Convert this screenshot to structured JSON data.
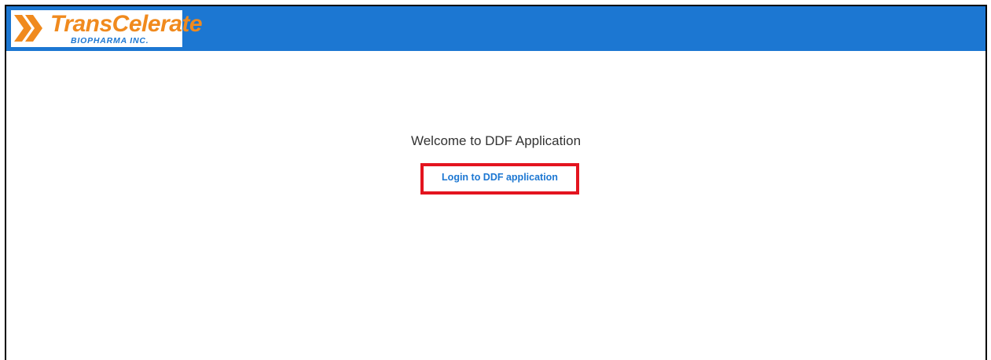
{
  "header": {
    "background_color": "#1c77d2",
    "logo": {
      "name": "TransCelerate",
      "subtitle": "BIOPHARMA INC.",
      "icon": "double-chevron-logo-icon",
      "primary_color": "#f08a1e",
      "secondary_color": "#1c77d2"
    }
  },
  "main": {
    "welcome_text": "Welcome to DDF Application",
    "login_link_label": "Login to DDF application",
    "login_link_color": "#1c77d2",
    "highlight_color": "#e3141f"
  }
}
